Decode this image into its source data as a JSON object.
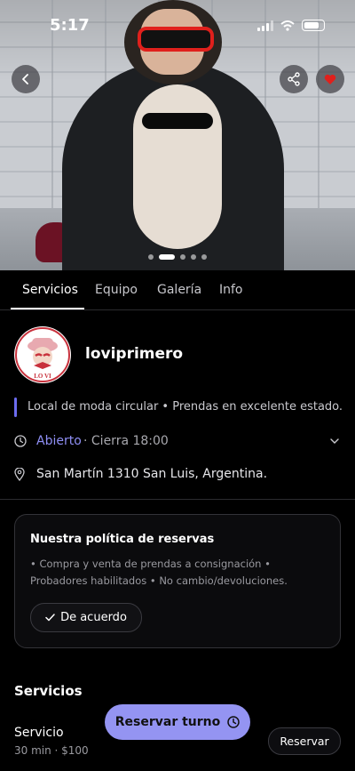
{
  "status_bar": {
    "time": "5:17",
    "icons": [
      "signal-icon",
      "wifi-icon",
      "battery-icon"
    ]
  },
  "hero": {
    "icons": {
      "back": "chevron-left-icon",
      "share": "share-icon",
      "favorite": "heart-icon"
    },
    "carousel": {
      "count": 5,
      "active": 1
    }
  },
  "tabs": [
    {
      "label": "Servicios",
      "active": true
    },
    {
      "label": "Equipo",
      "active": false
    },
    {
      "label": "Galería",
      "active": false
    },
    {
      "label": "Info",
      "active": false
    }
  ],
  "business": {
    "name": "loviprimero",
    "logo_text": "LO VI",
    "description": "Local de moda circular • Prendas en excelente estado.",
    "status": "Abierto",
    "closing": "· Cierra 18:00",
    "address": "San Martín 1310 San Luis, Argentina."
  },
  "policy": {
    "title": "Nuestra política de reservas",
    "text": "• Compra y venta de prendas a consignación • Probadores habilitados • No cambio/devoluciones.",
    "agree_label": "De acuerdo"
  },
  "services": {
    "section_title": "Servicios",
    "items": [
      {
        "name": "Servicio",
        "meta": "30 min · $100",
        "button_label": "Reservar"
      }
    ]
  },
  "floating_button": {
    "label": "Reservar turno"
  },
  "colors": {
    "accent": "#9494f2",
    "open_status": "#8f8ff5",
    "favorite": "#e0201c",
    "background": "#000000"
  }
}
